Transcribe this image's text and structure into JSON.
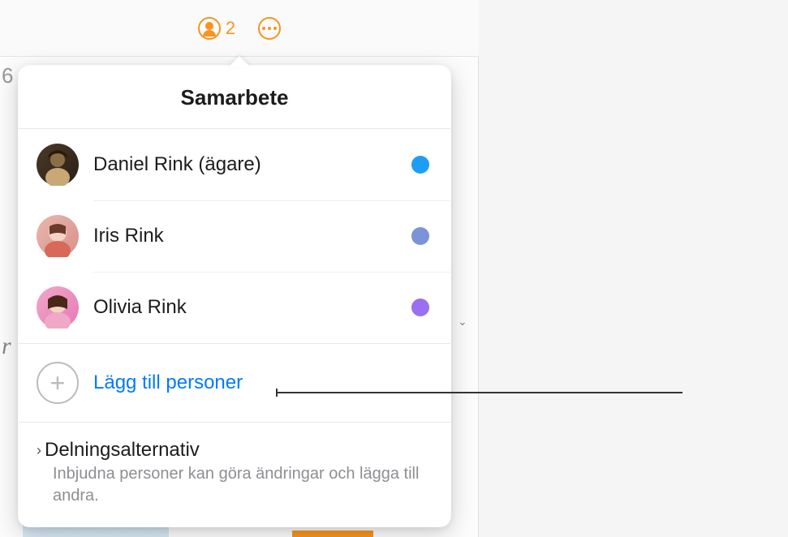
{
  "toolbar": {
    "collaborator_count": "2"
  },
  "popover": {
    "title": "Samarbete",
    "participants": [
      {
        "name": "Daniel Rink (ägare)",
        "status_color": "#1e9df7",
        "avatar_bg": "avatar-1"
      },
      {
        "name": "Iris Rink",
        "status_color": "#7a93d9",
        "avatar_bg": "avatar-2"
      },
      {
        "name": "Olivia Rink",
        "status_color": "#9a6ff0",
        "avatar_bg": "avatar-3"
      }
    ],
    "add_people_label": "Lägg till personer",
    "sharing_options": {
      "title": "Delningsalternativ",
      "description": "Inbjudna personer kan göra ändringar och lägga till andra."
    }
  },
  "background": {
    "char1": "6",
    "char2": "r"
  }
}
